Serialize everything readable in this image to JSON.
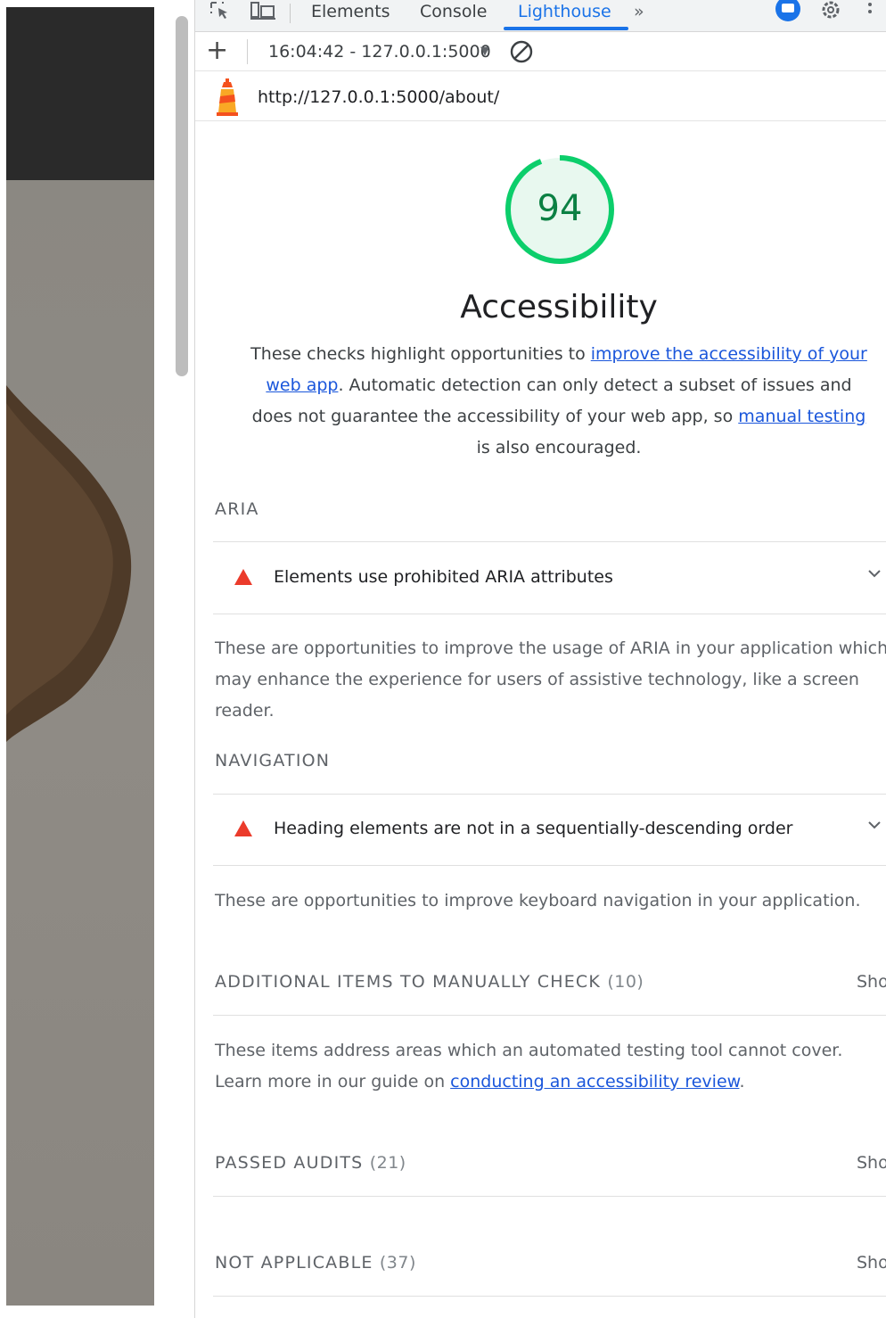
{
  "devtools": {
    "tabs": [
      {
        "label": "Elements"
      },
      {
        "label": "Console"
      },
      {
        "label": "Lighthouse"
      },
      {
        "label": "»"
      }
    ]
  },
  "toolbar": {
    "report_selector": "16:04:42 - 127.0.0.1:5000"
  },
  "report": {
    "url": "http://127.0.0.1:5000/about/",
    "category": {
      "score": "94",
      "title": "Accessibility",
      "desc_part1": "These checks highlight opportunities to ",
      "desc_link1": "improve the accessibility of your web app",
      "desc_part2": ". Automatic detection can only detect a subset of issues and does not guarantee the accessibility of your web app, so ",
      "desc_link2": "manual testing",
      "desc_part3": " is also encouraged."
    },
    "groups": {
      "aria": {
        "title": "ARIA",
        "audit": "Elements use prohibited ARIA attributes",
        "description": "These are opportunities to improve the usage of ARIA in your application which may enhance the experience for users of assistive technology, like a screen reader."
      },
      "navigation": {
        "title": "NAVIGATION",
        "audit": "Heading elements are not in a sequentially-descending order",
        "description": "These are opportunities to improve keyboard navigation in your application."
      },
      "manual": {
        "title": "ADDITIONAL ITEMS TO MANUALLY CHECK",
        "count": "(10)",
        "show": "Sho",
        "desc_part1": "These items address areas which an automated testing tool cannot cover. Learn more in our guide on ",
        "desc_link": "conducting an accessibility review",
        "desc_part2": "."
      },
      "passed": {
        "title": "PASSED AUDITS",
        "count": "(21)",
        "show": "Sho"
      },
      "not_applicable": {
        "title": "NOT APPLICABLE",
        "count": "(37)",
        "show": "Sho"
      }
    }
  },
  "colors": {
    "pass_green": "#0cce6b",
    "fail_red": "#eb3b2b",
    "link_blue": "#1a56db",
    "active_tab": "#1a73e8"
  }
}
